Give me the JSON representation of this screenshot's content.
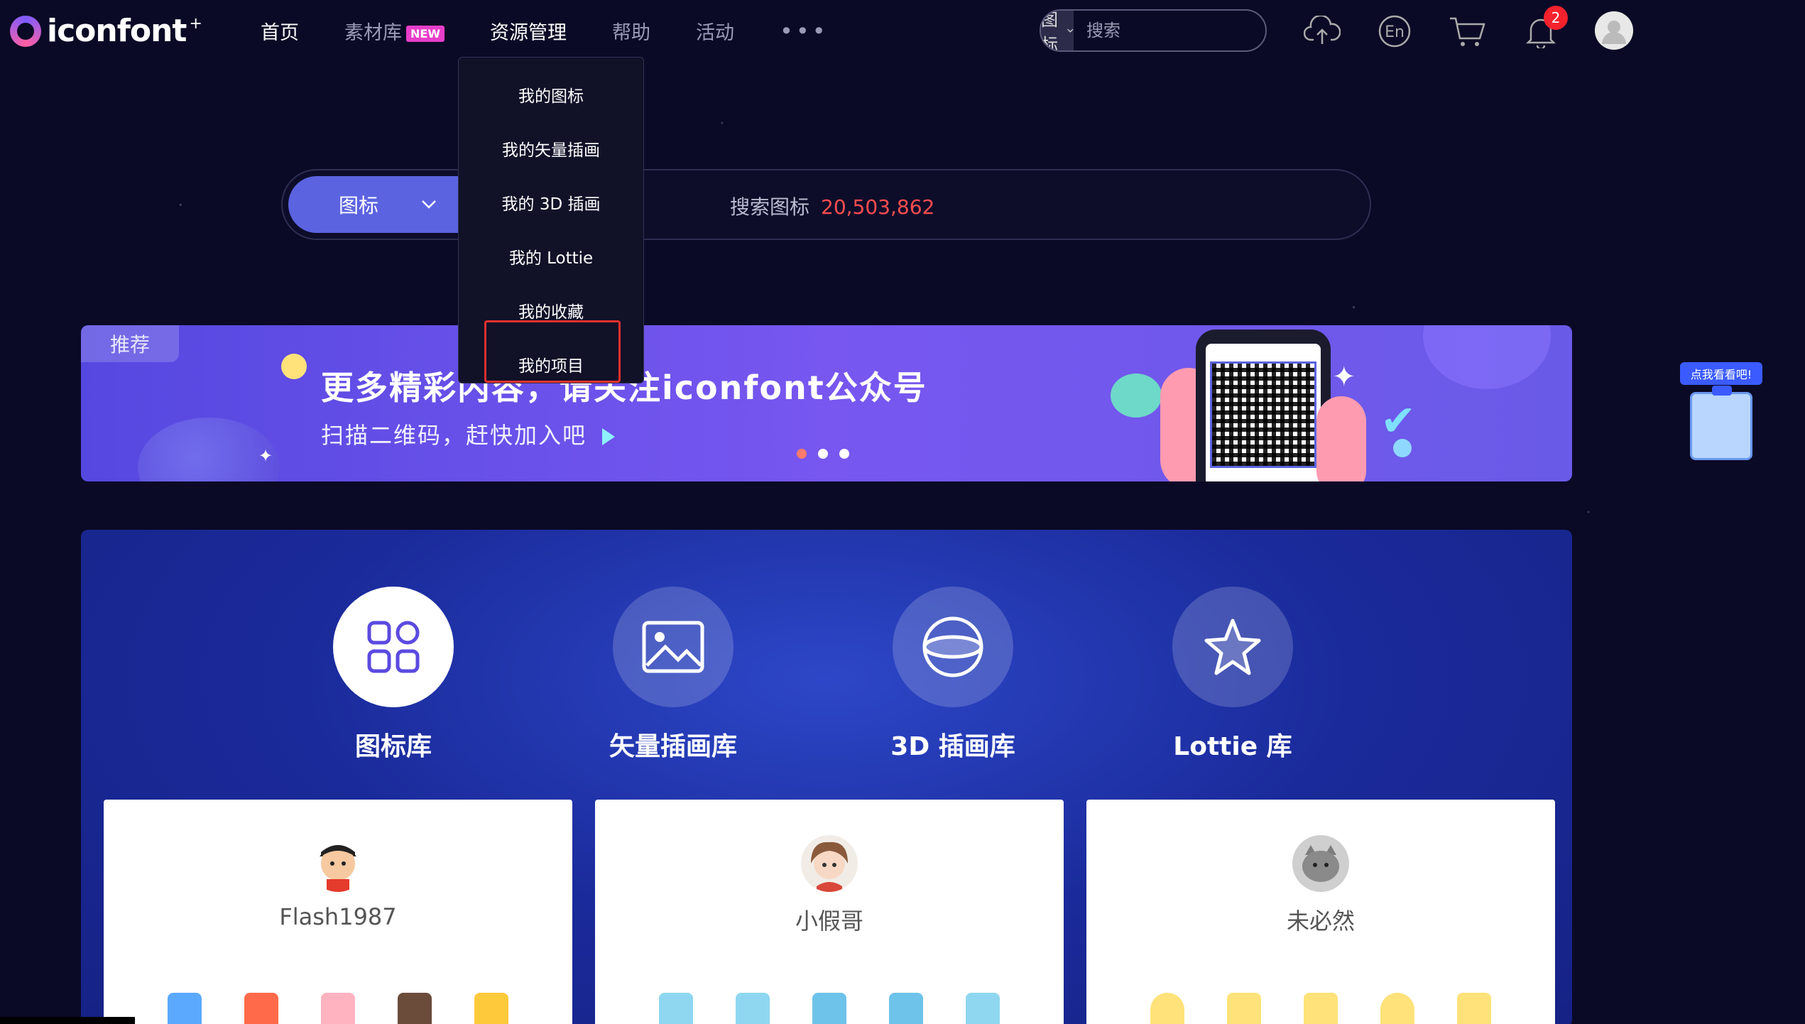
{
  "brand": {
    "name": "iconfont",
    "plus": "+"
  },
  "nav": {
    "items": [
      {
        "label": "首页"
      },
      {
        "label": "素材库",
        "badge": "NEW"
      },
      {
        "label": "资源管理"
      },
      {
        "label": "帮助"
      },
      {
        "label": "活动"
      }
    ],
    "more": "•••"
  },
  "search": {
    "type_label": "图标",
    "placeholder": "搜索"
  },
  "notifications": {
    "count": "2"
  },
  "dropdown": {
    "items": [
      {
        "label": "我的图标"
      },
      {
        "label": "我的矢量插画"
      },
      {
        "label": "我的 3D 插画"
      },
      {
        "label": "我的 Lottie"
      },
      {
        "label": "我的收藏"
      },
      {
        "label": "我的项目"
      }
    ]
  },
  "big_search": {
    "type_label": "图标",
    "hint": "搜索图标",
    "count": "20,503,862"
  },
  "banner": {
    "tag": "推荐",
    "title": "更多精彩内容，请关注iconfont公众号",
    "subtitle": "扫描二维码，赶快加入吧"
  },
  "float_widget": {
    "label": "点我看看吧!"
  },
  "libraries": [
    {
      "label": "图标库",
      "icon": "grid-icon"
    },
    {
      "label": "矢量插画库",
      "icon": "image-icon"
    },
    {
      "label": "3D 插画库",
      "icon": "sphere-icon"
    },
    {
      "label": "Lottie 库",
      "icon": "star-icon"
    }
  ],
  "cards": [
    {
      "name": "Flash1987"
    },
    {
      "name": "小假哥"
    },
    {
      "name": "未必然"
    }
  ],
  "colors": {
    "accent": "#5b63e0",
    "count": "#ff4d4f",
    "highlight": "#e5302d"
  }
}
